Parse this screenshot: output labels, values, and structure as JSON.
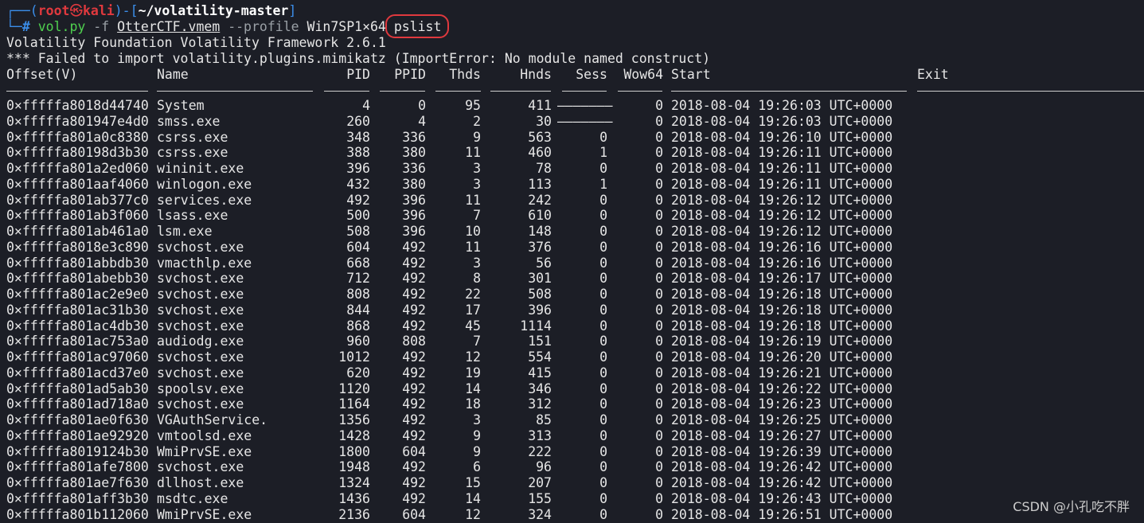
{
  "prompt": {
    "corner": "┌──(",
    "user": "root",
    "skull": "㉿",
    "host": "kali",
    "mid": ")-[",
    "path": "~/volatility-master",
    "end": "]",
    "hash_prefix": "└─",
    "hash": "#",
    "cmd": "vol.py",
    "flag_f": "-f",
    "file": "OtterCTF.vmem",
    "flag_profile": "--profile",
    "profile": "Win7SP1×64",
    "plugin": "pslist"
  },
  "output": {
    "line1": "Volatility Foundation Volatility Framework 2.6.1",
    "line2": "*** Failed to import volatility.plugins.mimikatz (ImportError: No module named construct)"
  },
  "headers": {
    "offset": "Offset(V)",
    "name": "Name",
    "pid": "PID",
    "ppid": "PPID",
    "thds": "Thds",
    "hnds": "Hnds",
    "sess": "Sess",
    "wow64": "Wow64",
    "start": "Start",
    "exit": "Exit"
  },
  "rows": [
    [
      "0×fffffa8018d44740",
      "System",
      "4",
      "0",
      "95",
      "411",
      "———————",
      "0",
      "2018-08-04 19:26:03 UTC+0000"
    ],
    [
      "0×fffffa801947e4d0",
      "smss.exe",
      "260",
      "4",
      "2",
      "30",
      "———————",
      "0",
      "2018-08-04 19:26:03 UTC+0000"
    ],
    [
      "0×fffffa801a0c8380",
      "csrss.exe",
      "348",
      "336",
      "9",
      "563",
      "0",
      "0",
      "2018-08-04 19:26:10 UTC+0000"
    ],
    [
      "0×fffffa80198d3b30",
      "csrss.exe",
      "388",
      "380",
      "11",
      "460",
      "1",
      "0",
      "2018-08-04 19:26:11 UTC+0000"
    ],
    [
      "0×fffffa801a2ed060",
      "wininit.exe",
      "396",
      "336",
      "3",
      "78",
      "0",
      "0",
      "2018-08-04 19:26:11 UTC+0000"
    ],
    [
      "0×fffffa801aaf4060",
      "winlogon.exe",
      "432",
      "380",
      "3",
      "113",
      "1",
      "0",
      "2018-08-04 19:26:11 UTC+0000"
    ],
    [
      "0×fffffa801ab377c0",
      "services.exe",
      "492",
      "396",
      "11",
      "242",
      "0",
      "0",
      "2018-08-04 19:26:12 UTC+0000"
    ],
    [
      "0×fffffa801ab3f060",
      "lsass.exe",
      "500",
      "396",
      "7",
      "610",
      "0",
      "0",
      "2018-08-04 19:26:12 UTC+0000"
    ],
    [
      "0×fffffa801ab461a0",
      "lsm.exe",
      "508",
      "396",
      "10",
      "148",
      "0",
      "0",
      "2018-08-04 19:26:12 UTC+0000"
    ],
    [
      "0×fffffa8018e3c890",
      "svchost.exe",
      "604",
      "492",
      "11",
      "376",
      "0",
      "0",
      "2018-08-04 19:26:16 UTC+0000"
    ],
    [
      "0×fffffa801abbdb30",
      "vmacthlp.exe",
      "668",
      "492",
      "3",
      "56",
      "0",
      "0",
      "2018-08-04 19:26:16 UTC+0000"
    ],
    [
      "0×fffffa801abebb30",
      "svchost.exe",
      "712",
      "492",
      "8",
      "301",
      "0",
      "0",
      "2018-08-04 19:26:17 UTC+0000"
    ],
    [
      "0×fffffa801ac2e9e0",
      "svchost.exe",
      "808",
      "492",
      "22",
      "508",
      "0",
      "0",
      "2018-08-04 19:26:18 UTC+0000"
    ],
    [
      "0×fffffa801ac31b30",
      "svchost.exe",
      "844",
      "492",
      "17",
      "396",
      "0",
      "0",
      "2018-08-04 19:26:18 UTC+0000"
    ],
    [
      "0×fffffa801ac4db30",
      "svchost.exe",
      "868",
      "492",
      "45",
      "1114",
      "0",
      "0",
      "2018-08-04 19:26:18 UTC+0000"
    ],
    [
      "0×fffffa801ac753a0",
      "audiodg.exe",
      "960",
      "808",
      "7",
      "151",
      "0",
      "0",
      "2018-08-04 19:26:19 UTC+0000"
    ],
    [
      "0×fffffa801ac97060",
      "svchost.exe",
      "1012",
      "492",
      "12",
      "554",
      "0",
      "0",
      "2018-08-04 19:26:20 UTC+0000"
    ],
    [
      "0×fffffa801acd37e0",
      "svchost.exe",
      "620",
      "492",
      "19",
      "415",
      "0",
      "0",
      "2018-08-04 19:26:21 UTC+0000"
    ],
    [
      "0×fffffa801ad5ab30",
      "spoolsv.exe",
      "1120",
      "492",
      "14",
      "346",
      "0",
      "0",
      "2018-08-04 19:26:22 UTC+0000"
    ],
    [
      "0×fffffa801ad718a0",
      "svchost.exe",
      "1164",
      "492",
      "18",
      "312",
      "0",
      "0",
      "2018-08-04 19:26:23 UTC+0000"
    ],
    [
      "0×fffffa801ae0f630",
      "VGAuthService.",
      "1356",
      "492",
      "3",
      "85",
      "0",
      "0",
      "2018-08-04 19:26:25 UTC+0000"
    ],
    [
      "0×fffffa801ae92920",
      "vmtoolsd.exe",
      "1428",
      "492",
      "9",
      "313",
      "0",
      "0",
      "2018-08-04 19:26:27 UTC+0000"
    ],
    [
      "0×fffffa8019124b30",
      "WmiPrvSE.exe",
      "1800",
      "604",
      "9",
      "222",
      "0",
      "0",
      "2018-08-04 19:26:39 UTC+0000"
    ],
    [
      "0×fffffa801afe7800",
      "svchost.exe",
      "1948",
      "492",
      "6",
      "96",
      "0",
      "0",
      "2018-08-04 19:26:42 UTC+0000"
    ],
    [
      "0×fffffa801ae7f630",
      "dllhost.exe",
      "1324",
      "492",
      "15",
      "207",
      "0",
      "0",
      "2018-08-04 19:26:42 UTC+0000"
    ],
    [
      "0×fffffa801aff3b30",
      "msdtc.exe",
      "1436",
      "492",
      "14",
      "155",
      "0",
      "0",
      "2018-08-04 19:26:43 UTC+0000"
    ],
    [
      "0×fffffa801b112060",
      "WmiPrvSE.exe",
      "2136",
      "604",
      "12",
      "324",
      "0",
      "0",
      "2018-08-04 19:26:51 UTC+0000"
    ]
  ],
  "watermark": "CSDN @小孔吃不胖",
  "colors": {
    "background": "#1c1e26",
    "prompt_blue": "#3b8eea",
    "root_red": "#e0393e",
    "cmd_green": "#4fd14f",
    "highlight": "#e0393e"
  }
}
